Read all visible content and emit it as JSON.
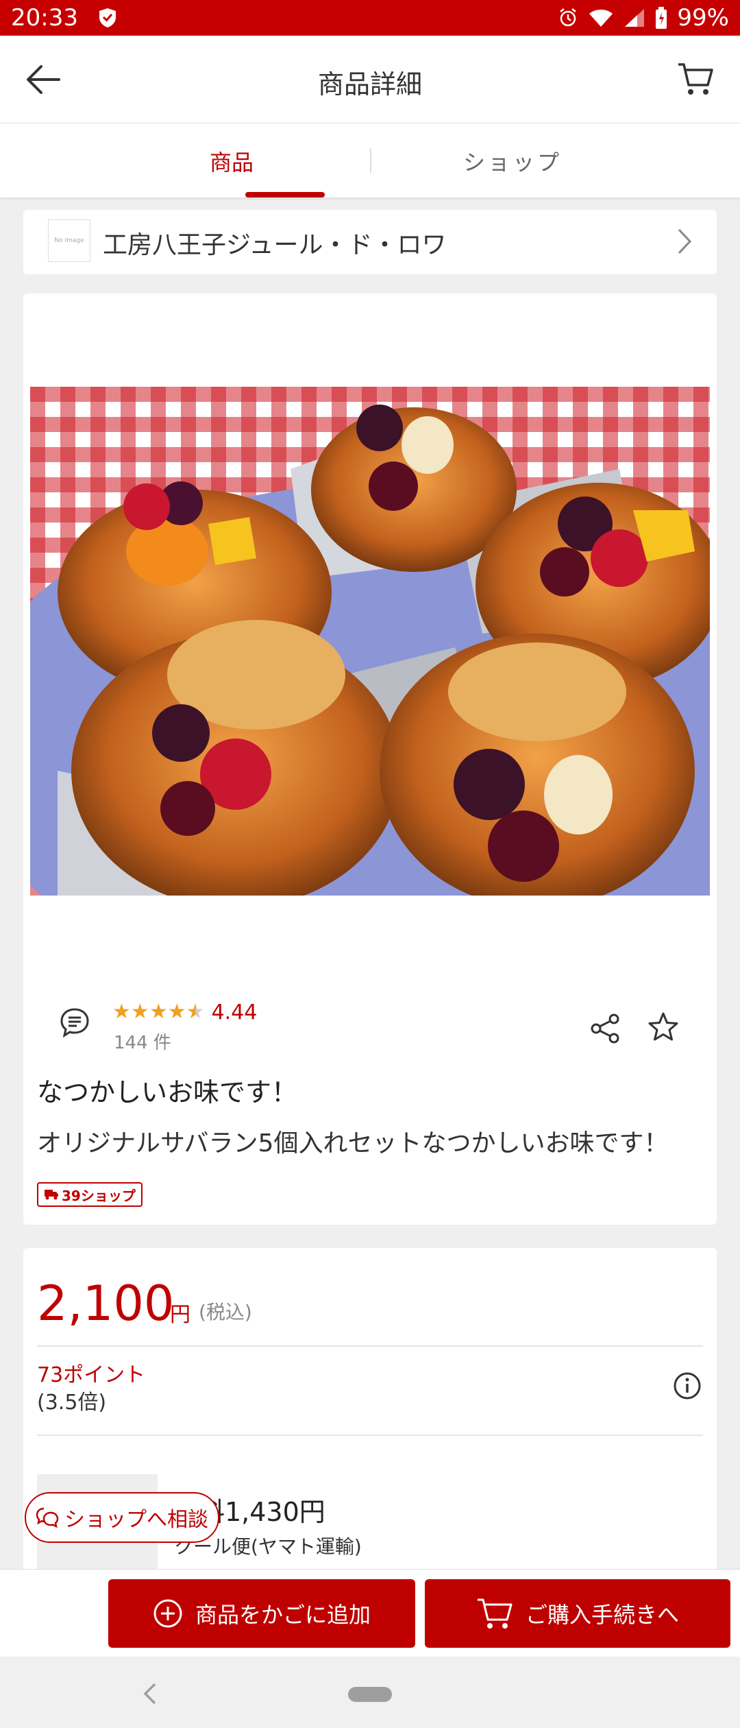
{
  "status_bar": {
    "time": "20:33",
    "battery": "99%"
  },
  "app_bar": {
    "title": "商品詳細"
  },
  "tabs": {
    "product": "商品",
    "shop": "ショップ"
  },
  "shop": {
    "noimage": "No Image",
    "name": "工房八王子ジュール・ド・ロワ"
  },
  "product": {
    "rating": "4.44",
    "rating_value": 4.44,
    "stars": [
      "★",
      "★",
      "★",
      "★",
      "★"
    ],
    "review_count": "144 件",
    "catch_copy": "なつかしいお味です！",
    "name": "オリジナルサバラン5個入れセットなつかしいお味です！",
    "shipping_badge": "39ショップ"
  },
  "price": {
    "amount": "2,100",
    "unit": "円",
    "tax": "(税込)",
    "points": "73ポイント",
    "points_rate": "(3.5倍)",
    "shipping_fee": "料1,430円",
    "shipping_method": "クール便(ヤマト運輸)"
  },
  "consult_button": "ショップへ相談",
  "actions": {
    "add_to_cart": "商品をかごに追加",
    "checkout": "ご購入手続きへ"
  },
  "colors": {
    "brand": "#bf0000",
    "star": "#f0a020"
  }
}
